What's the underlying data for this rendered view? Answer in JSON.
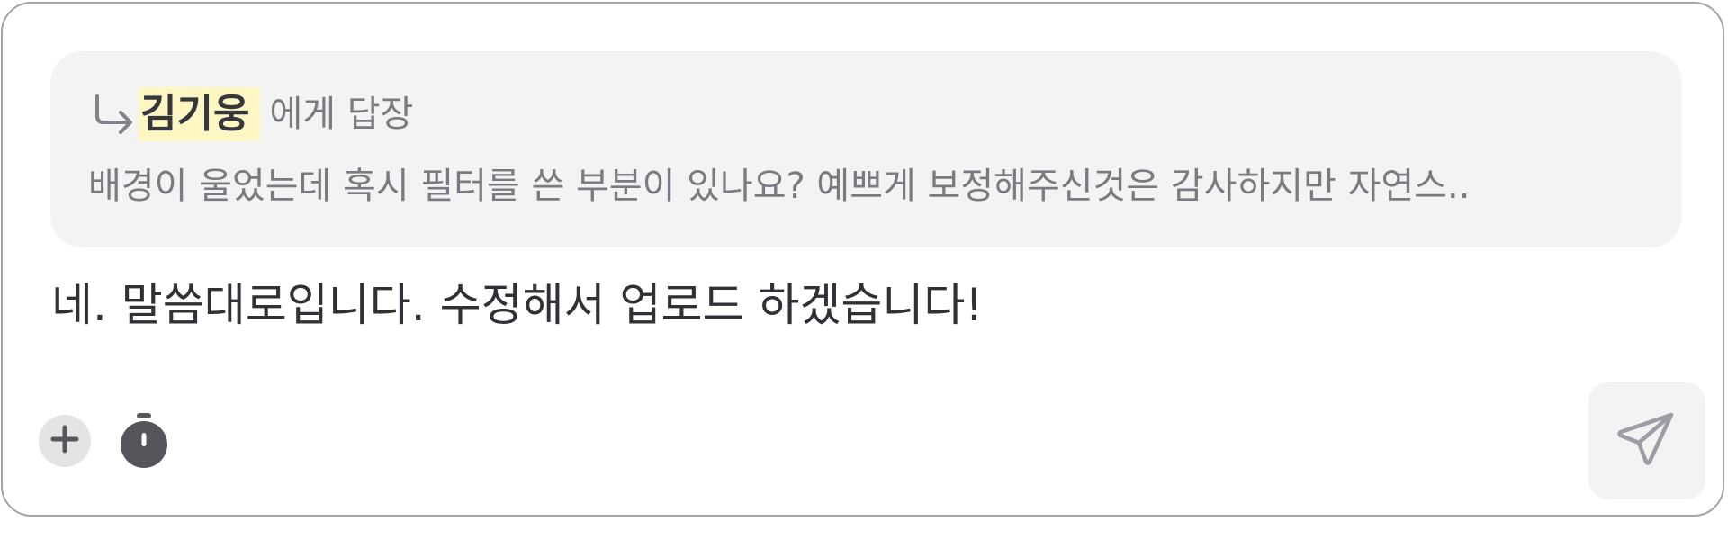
{
  "reply": {
    "recipient_name": "김기웅",
    "recipient_suffix": "에게 답장",
    "quoted_text": "배경이 울었는데 혹시 필터를 쓴 부분이 있나요? 예쁘게 보정해주신것은 감사하지만 자연스.."
  },
  "composer": {
    "message": "네. 말씀대로입니다. 수정해서 업로드 하겠습니다!"
  },
  "icons": {
    "reply_arrow": "reply-arrow-icon",
    "add": "plus-icon",
    "timer": "stopwatch-icon",
    "send": "paper-plane-icon"
  },
  "colors": {
    "highlight": "#fef7c4",
    "preview_background": "#f3f3f4",
    "icon_dark": "#55565c",
    "muted_text": "#7a7b80",
    "send_icon": "#9d9ea5"
  }
}
